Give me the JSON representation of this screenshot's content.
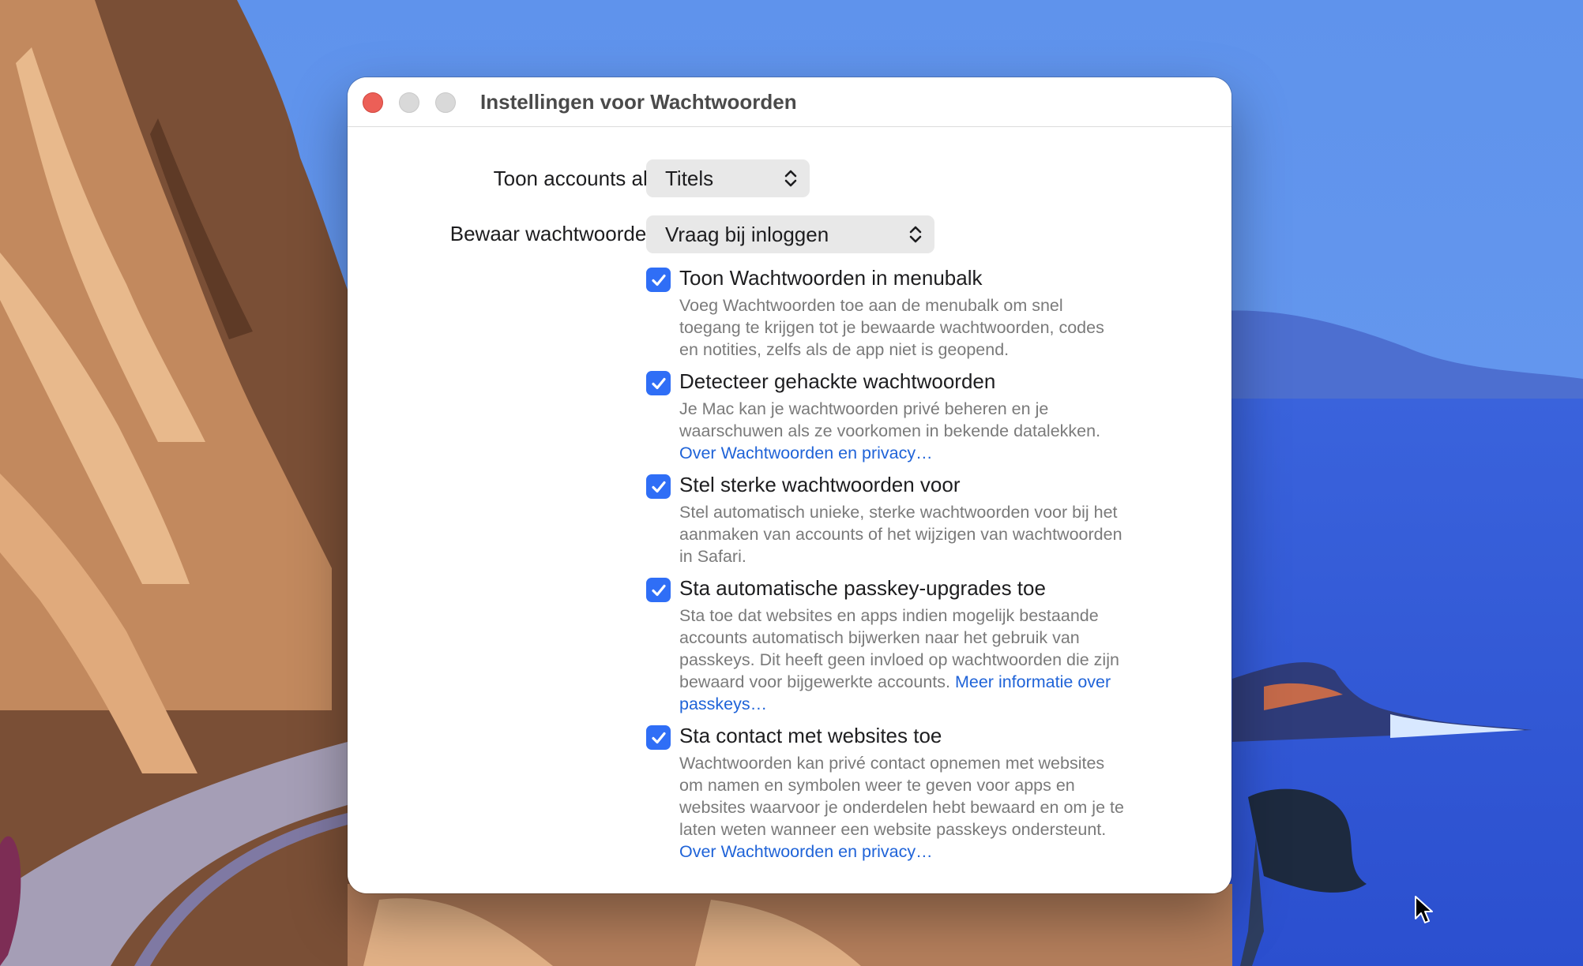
{
  "window": {
    "title": "Instellingen voor Wachtwoorden"
  },
  "settings": {
    "show_accounts_label": "Toon accounts als:",
    "show_accounts_value": "Titels",
    "save_passwords_label": "Bewaar wachtwoorden:",
    "save_passwords_value": "Vraag bij inloggen"
  },
  "options": [
    {
      "checked": true,
      "title": "Toon Wachtwoorden in menubalk",
      "desc_1": "Voeg Wachtwoorden toe aan de menubalk om snel",
      "desc_2": "toegang te krijgen tot je bewaarde wachtwoorden, codes",
      "desc_3": "en notities, zelfs als de app niet is geopend."
    },
    {
      "checked": true,
      "title": "Detecteer gehackte wachtwoorden",
      "desc_1": "Je Mac kan je wachtwoorden privé beheren en je",
      "desc_2": "waarschuwen als ze voorkomen in bekende datalekken.",
      "link": "Over Wachtwoorden en privacy…"
    },
    {
      "checked": true,
      "title": "Stel sterke wachtwoorden voor",
      "desc_1": "Stel automatisch unieke, sterke wachtwoorden voor bij het",
      "desc_2": "aanmaken van accounts of het wijzigen van wachtwoorden",
      "desc_3": "in Safari."
    },
    {
      "checked": true,
      "title": "Sta automatische passkey-upgrades toe",
      "desc_1": "Sta toe dat websites en apps indien mogelijk bestaande",
      "desc_2": "accounts automatisch bijwerken naar het gebruik van",
      "desc_3": "passkeys. Dit heeft geen invloed op wachtwoorden die zijn",
      "desc_4": "bewaard voor bijgewerkte accounts.",
      "link_a": "Meer informatie over",
      "link_b": "passkeys…"
    },
    {
      "checked": true,
      "title": "Sta contact met websites toe",
      "desc_1": "Wachtwoorden kan privé contact opnemen met websites",
      "desc_2": "om namen en symbolen weer te geven voor apps en",
      "desc_3": "websites waarvoor je onderdelen hebt bewaard en om je te",
      "desc_4": "laten weten wanneer een website passkeys ondersteunt.",
      "link": "Over Wachtwoorden en privacy…"
    }
  ],
  "colors": {
    "accent": "#2f6ef6",
    "link": "#1f63d8",
    "close": "#ec5f57"
  }
}
